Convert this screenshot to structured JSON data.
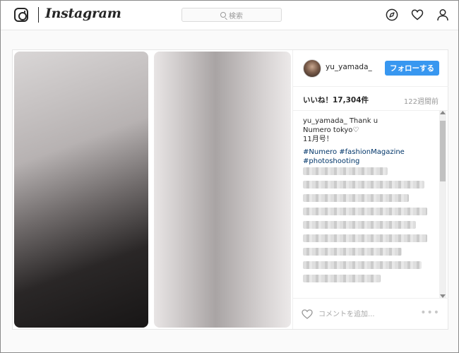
{
  "header": {
    "wordmark": "Instagram",
    "search_placeholder": "検索"
  },
  "post": {
    "username": "yu_yamada_",
    "follow_label": "フォローする",
    "likes": "いいね！17,304件",
    "time_ago": "122週間前",
    "caption_lines": [
      "yu_yamada_  Thank u",
      "Numero tokyo♡",
      "11月号！"
    ],
    "hashtags": [
      "#Numero #fashionMagazine",
      "#photoshooting"
    ],
    "comment_placeholder": "コメントを追加...",
    "more_label": "•••"
  },
  "colors": {
    "accent": "#3897f0",
    "hashtag": "#003569"
  },
  "icons": [
    "camera-logo-icon",
    "search-icon",
    "compass-icon",
    "heart-icon",
    "profile-icon",
    "like-heart-icon"
  ]
}
